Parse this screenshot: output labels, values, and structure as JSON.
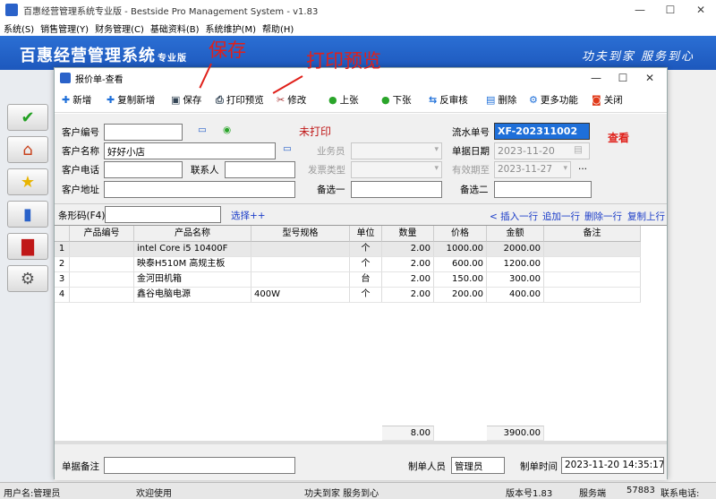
{
  "window": {
    "title": "百惠经营管理系统专业版 - Bestside Pro Management System - v1.83",
    "minimize": "—",
    "maximize": "☐",
    "close": "✕"
  },
  "menu": [
    "系统(S)",
    "销售管理(Y)",
    "财务管理(C)",
    "基础资料(B)",
    "系统维护(M)",
    "帮助(H)"
  ],
  "banner": {
    "brand": "百惠经营管理系统",
    "brand_suffix": "专业版",
    "slogan": "功夫到家 服务到心"
  },
  "child": {
    "title": "报价单-查看",
    "toolbar": [
      {
        "label": "新增",
        "icon": "plus-icon",
        "color": "#1e6fd9"
      },
      {
        "label": "复制新增",
        "icon": "plus-icon",
        "color": "#1e6fd9"
      },
      {
        "label": "保存",
        "icon": "save-icon",
        "color": "#345"
      },
      {
        "label": "打印预览",
        "icon": "print-icon",
        "color": "#345"
      },
      {
        "label": "修改",
        "icon": "scissors-icon",
        "color": "#a33"
      },
      {
        "label": "上张",
        "icon": "up-circle-icon",
        "color": "#2aa52a"
      },
      {
        "label": "下张",
        "icon": "down-circle-icon",
        "color": "#2aa52a"
      },
      {
        "label": "反审核",
        "icon": "undo-icon",
        "color": "#1e6fd9"
      },
      {
        "label": "删除",
        "icon": "delete-icon",
        "color": "#1e6fd9"
      },
      {
        "label": "更多功能",
        "icon": "gear-icon",
        "color": "#1e6fd9"
      },
      {
        "label": "关闭",
        "icon": "close-icon",
        "color": "#e03a1a"
      }
    ],
    "form": {
      "customer_code_label": "客户编号",
      "customer_code": "",
      "customer_name_label": "客户名称",
      "customer_name": "好好小店",
      "customer_phone_label": "客户电话",
      "customer_phone": "",
      "contact_label": "联系人",
      "contact": "",
      "customer_address_label": "客户地址",
      "customer_address": "",
      "print_status": "未打印",
      "salesperson_label": "业务员",
      "salesperson": "",
      "invoice_type_label": "发票类型",
      "invoice_type": "",
      "option1_label": "备选一",
      "option1": "",
      "serial_label": "流水单号",
      "serial": "XF-202311002",
      "view_status": "查看",
      "date_label": "单据日期",
      "date": "2023-11-20",
      "valid_label": "有效期至",
      "valid": "2023-11-27",
      "option2_label": "备选二",
      "option2": ""
    },
    "barcode_label": "条形码(F4)",
    "select_link": "选择++",
    "row_actions": [
      "< 插入一行",
      "追加一行",
      "删除一行",
      "复制上行"
    ],
    "grid": {
      "headers": [
        "",
        "产品编号",
        "产品名称",
        "型号规格",
        "单位",
        "数量",
        "价格",
        "金额",
        "备注"
      ],
      "rows": [
        [
          "1",
          "",
          "intel Core i5 10400F",
          "",
          "个",
          "2.00",
          "1000.00",
          "2000.00",
          ""
        ],
        [
          "2",
          "",
          "映泰H510M 高规主板",
          "",
          "个",
          "2.00",
          "600.00",
          "1200.00",
          ""
        ],
        [
          "3",
          "",
          "金河田机箱",
          "",
          "台",
          "2.00",
          "150.00",
          "300.00",
          ""
        ],
        [
          "4",
          "",
          "鑫谷电脑电源",
          "400W",
          "个",
          "2.00",
          "200.00",
          "400.00",
          ""
        ]
      ],
      "total_qty": "8.00",
      "total_amount": "3900.00"
    },
    "footer": {
      "remark_label": "单据备注",
      "remark": "",
      "maker_label": "制单人员",
      "maker": "管理员",
      "time_label": "制单时间",
      "time": "2023-11-20 14:35:17"
    }
  },
  "annotations": {
    "save": "保存",
    "print_preview": "打印预览"
  },
  "status": {
    "user": "用户名:管理员",
    "welcome": "欢迎使用",
    "slogan": "功夫到家 服务到心",
    "version": "版本号1.83",
    "service": "服务端",
    "port": "57883",
    "contact": "联系电话:"
  }
}
